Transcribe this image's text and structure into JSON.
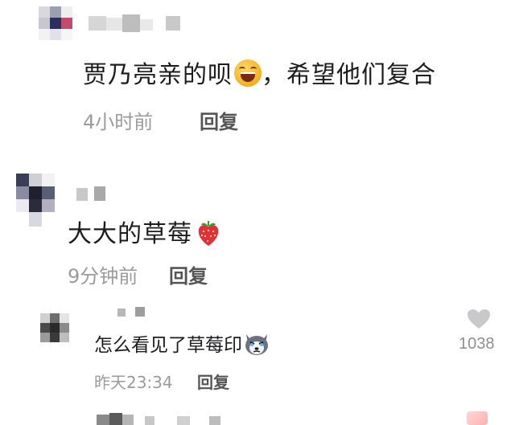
{
  "comments": [
    {
      "text": "贾乃亮亲的呗",
      "text_after_emoji": "，希望他们复合",
      "emoji": "laughing-face-emoji",
      "time": "4小时前",
      "reply_label": "回复"
    },
    {
      "text": "大大的草莓",
      "emoji": "strawberry-emoji",
      "time": "9分钟前",
      "reply_label": "回复"
    }
  ],
  "reply": {
    "text": "怎么看见了草莓印",
    "emoji": "husky-dog-emoji",
    "time": "昨天23:34",
    "reply_label": "回复",
    "like_count": "1038",
    "like_icon": "heart-icon"
  }
}
